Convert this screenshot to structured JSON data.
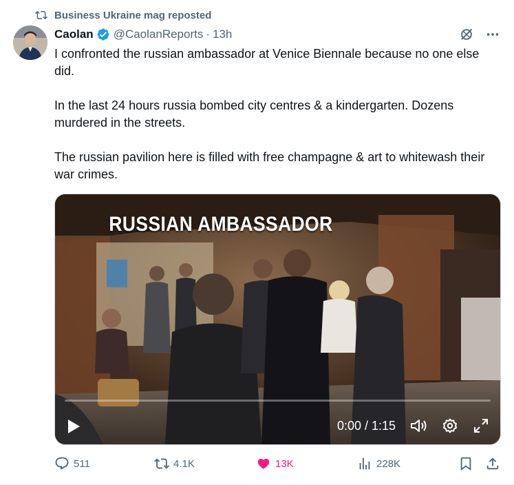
{
  "repost": {
    "label": "Business Ukraine mag reposted"
  },
  "author": {
    "name": "Caolan",
    "handle": "@CaolanReports",
    "separator": "·",
    "time": "13h"
  },
  "tweet": {
    "paragraphs": [
      "I confronted the russian ambassador at Venice Biennale because no one else did.",
      "In the last 24 hours russia bombed city centres & a kindergarten. Dozens murdered in the streets.",
      "The russian pavilion here is filled with free champagne & art to whitewash their war crimes."
    ]
  },
  "video": {
    "caption": "RUSSIAN AMBASSADOR",
    "time": "0:00 / 1:15"
  },
  "actions": {
    "replies": "511",
    "reposts": "4.1K",
    "likes": "13K",
    "views": "228K"
  },
  "colors": {
    "accent": "#1d9bf0",
    "like": "#f91880",
    "muted": "#536471",
    "text": "#0f1419"
  },
  "icons": [
    "repost-icon",
    "verified-badge-icon",
    "grok-icon",
    "more-icon",
    "play-icon",
    "volume-icon",
    "settings-icon",
    "fullscreen-icon",
    "reply-icon",
    "like-icon",
    "views-icon",
    "bookmark-icon",
    "share-icon"
  ]
}
